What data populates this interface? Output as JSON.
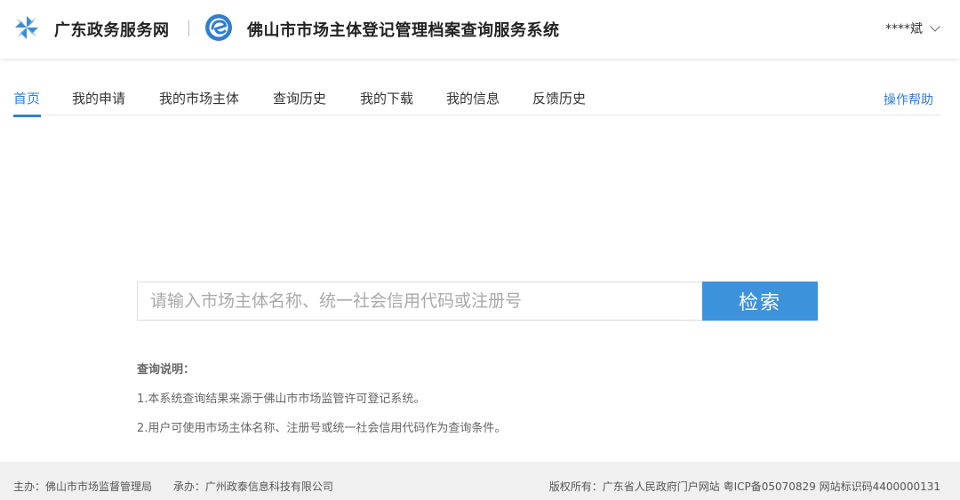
{
  "header": {
    "portal_name": "广东政务服务网",
    "system_name": "佛山市市场主体登记管理档案查询服务系统",
    "user_name": "****斌"
  },
  "nav": {
    "items": [
      {
        "label": "首页",
        "active": true
      },
      {
        "label": "我的申请"
      },
      {
        "label": "我的市场主体"
      },
      {
        "label": "查询历史"
      },
      {
        "label": "我的下载"
      },
      {
        "label": "我的信息"
      },
      {
        "label": "反馈历史"
      }
    ],
    "help_label": "操作帮助"
  },
  "search": {
    "placeholder": "请输入市场主体名称、统一社会信用代码或注册号",
    "value": "",
    "button_label": "检索"
  },
  "notes": {
    "title": "查询说明：",
    "lines": [
      "1.本系统查询结果来源于佛山市市场监管许可登记系统。",
      "2.用户可使用市场主体名称、注册号或统一社会信用代码作为查询条件。"
    ]
  },
  "footer": {
    "organizer": "主办：佛山市市场监督管理局",
    "undertaker": "承办：广州政泰信息科技有限公司",
    "copyright": "版权所有：广东省人民政府门户网站 粤ICP备05070829 网站标识码4400000131"
  },
  "colors": {
    "accent": "#2f7fd1",
    "button": "#3d92dc",
    "footer_bg": "#f0f0f0"
  },
  "icons": {
    "portal_logo": "portal-pinwheel-icon",
    "system_logo": "system-e-logo-icon",
    "user_chevron": "chevron-down-icon"
  }
}
